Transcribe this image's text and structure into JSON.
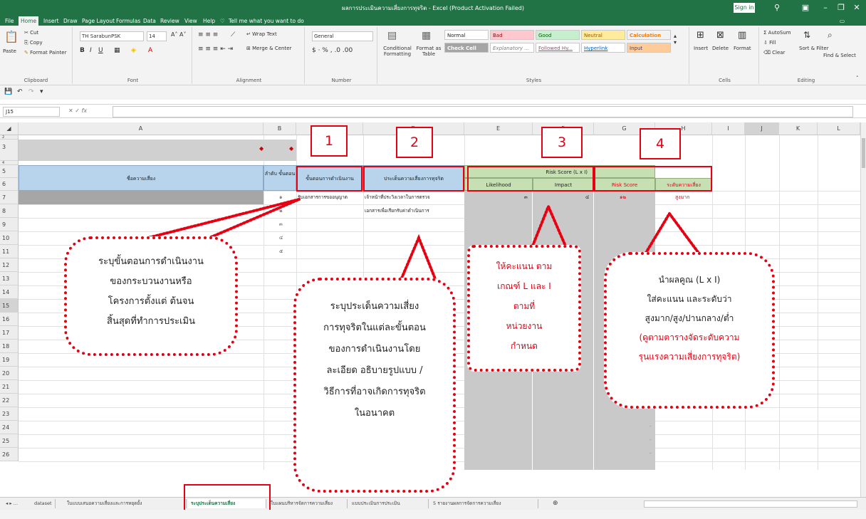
{
  "window": {
    "title": "ผลการประเมินความเสี่ยงการทุจริต - Excel (Product Activation Failed)",
    "signin": "Sign in"
  },
  "menu": [
    "File",
    "Home",
    "Insert",
    "Draw",
    "Page Layout",
    "Formulas",
    "Data",
    "Review",
    "View",
    "Help",
    "Tell me what you want to do"
  ],
  "ribbon": {
    "clipboard": {
      "cut": "Cut",
      "copy": "Copy",
      "paste": "Paste",
      "format_painter": "Format Painter",
      "label": "Clipboard"
    },
    "font": {
      "name": "TH SarabunPSK",
      "size": "14",
      "label": "Font"
    },
    "alignment": {
      "wrap": "Wrap Text",
      "merge": "Merge & Center",
      "label": "Alignment"
    },
    "number": {
      "format": "General",
      "label": "Number"
    },
    "styles": {
      "conditional": "Conditional Formatting",
      "format_as_table": "Format as Table",
      "normal": "Normal",
      "bad": "Bad",
      "good": "Good",
      "neutral": "Neutral",
      "calculation": "Calculation",
      "check_cell": "Check Cell",
      "explanatory": "Explanatory ...",
      "followed": "Followed Hy...",
      "hyperlink": "Hyperlink",
      "input": "Input",
      "label": "Styles"
    },
    "cells": {
      "insert": "Insert",
      "delete": "Delete",
      "format": "Format",
      "label": "Cells"
    },
    "editing": {
      "autosum": "AutoSum",
      "fill": "Fill",
      "clear": "Clear",
      "sort": "Sort & Filter",
      "find": "Find & Select",
      "label": "Editing"
    }
  },
  "formula_bar": {
    "name_box": "J15",
    "fx": "fx"
  },
  "columns": [
    "A",
    "B",
    "C",
    "D",
    "E",
    "F",
    "G",
    "H",
    "I",
    "J",
    "K",
    "L"
  ],
  "rows": [
    "2",
    "3",
    "4",
    "5",
    "6",
    "7",
    "8",
    "9",
    "10",
    "11",
    "12",
    "13",
    "14",
    "15",
    "16",
    "17",
    "18",
    "19",
    "20",
    "21",
    "22",
    "23",
    "24",
    "25",
    "26"
  ],
  "sheet": {
    "risk_name_header": "ชื่อความเสี่ยง",
    "order_header": "ลำดับ ขั้นตอน",
    "process_header": "ขั้นตอนการดำเนินงาน",
    "issue_header": "ประเด็นความเสี่ยงการทุจริต",
    "risk_score_header": "Risk Score (L x I)",
    "likelihood": "Likelihood",
    "impact": "Impact",
    "risk_score": "Risk Score",
    "risk_level": "ระดับความเสี่ยง",
    "order_values": [
      "๑",
      "๒",
      "๓",
      "๔",
      "๕"
    ],
    "process_row7": "รับเอกสารการขออนุญาต",
    "issue_row7": "เจ้าหน้าที่ประวิงเวลาในการตรวจ",
    "issue_row8": "เอกสารเพื่อเรียกรับค่าดำเนินการ",
    "likelihood_row7": "๓",
    "impact_row7": "๔",
    "score_row7": "๑๒",
    "level_row7": "สูงมาก",
    "dash": "-"
  },
  "callouts": {
    "numbers": [
      "1",
      "2",
      "3",
      "4"
    ],
    "c1": [
      "ระบุขั้นตอนการดำเนินงาน",
      "ของกระบวนงานหรือ",
      "โครงการตั้งแต่ ต้นจน",
      "สิ้นสุดที่ทำการประเมิน"
    ],
    "c2": [
      "ระบุประเด็นความเสี่ยง",
      "การทุจริตในแต่ละขั้นตอน",
      "ของการดำเนินงานโดย",
      "ละเอียด อธิบายรูปแบบ /",
      "วิธีการที่อาจเกิดการทุจริต",
      "ในอนาคต"
    ],
    "c3": [
      "ให้คะแนน ตาม",
      "เกณฑ์ L และ I",
      "ตามที่",
      "หน่วยงาน",
      "กำหนด"
    ],
    "c4_black": [
      "นำผลคูณ (L x I)",
      "ใส่คะแนน และระดับว่า",
      "สูงมาก/สูง/ปานกลาง/ต่ำ"
    ],
    "c4_red": [
      "(ดูตามตารางจัดระดับความ",
      "รุนแรงความเสี่ยงการทุจริต)"
    ]
  },
  "sheet_tabs": [
    "dataset",
    "ใบแบบเสนอความเสี่ยงและการหยุดยั้ง",
    "ระบุประเด็นความเสี่ยง",
    "ใบแผนบริหารจัดการความเสี่ยง",
    "แบบประเมินการประเมิน",
    "5 รายงานผลการจัดการความเสี่ยง"
  ],
  "colors": {
    "excel_green": "#217346",
    "callout_red": "#e60012",
    "header_blue": "#b7d4ec",
    "header_green": "#c6e0b4",
    "score_gray": "#c9c9c9"
  }
}
